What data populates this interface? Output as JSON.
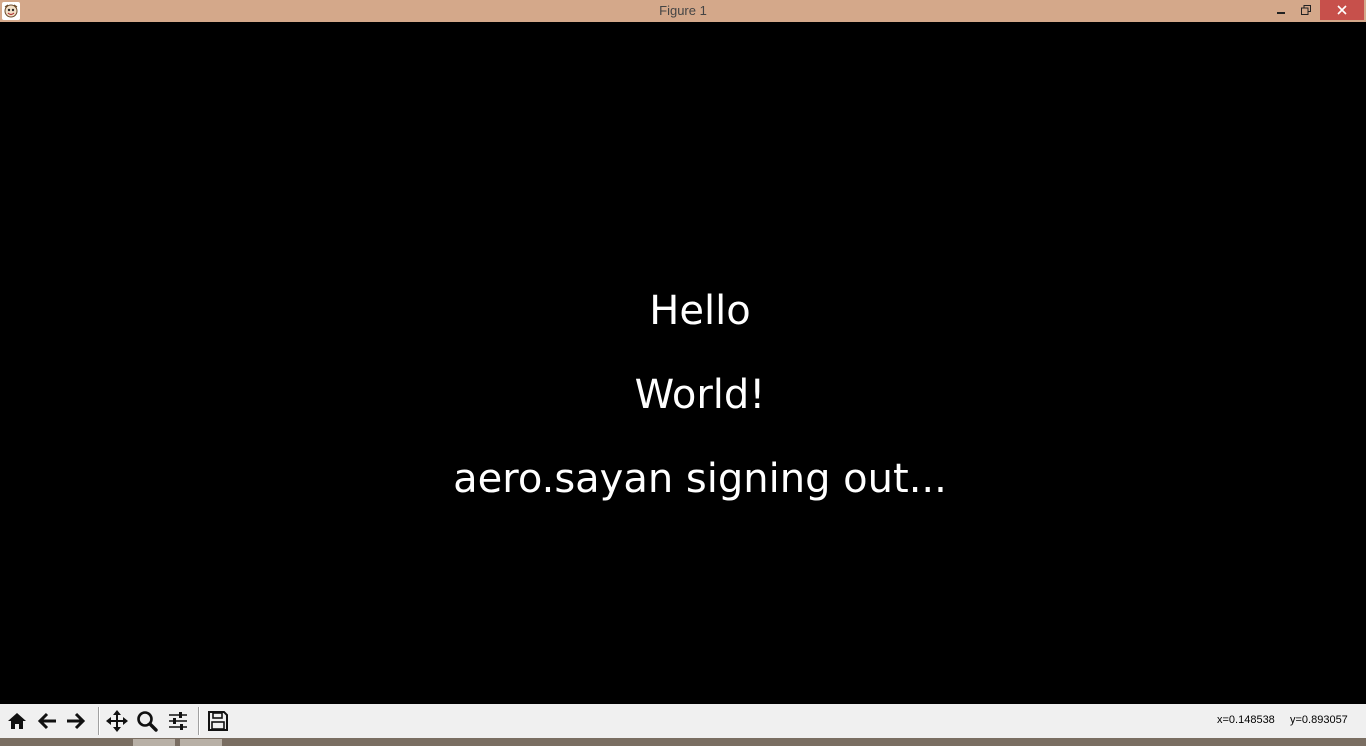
{
  "window": {
    "title": "Figure 1",
    "titlebar_color": "#d4a88a",
    "close_color": "#c7504b",
    "buttons": {
      "minimize": "minimize-icon",
      "maximize": "restore-icon",
      "close": "close-icon"
    }
  },
  "figure": {
    "background": "#000000",
    "text_color": "#ffffff",
    "lines": [
      "Hello",
      "World!",
      "aero.sayan signing out..."
    ]
  },
  "toolbar": {
    "buttons": [
      {
        "name": "home",
        "icon": "home-icon"
      },
      {
        "name": "back",
        "icon": "arrow-left-icon"
      },
      {
        "name": "forward",
        "icon": "arrow-right-icon"
      },
      {
        "name": "pan",
        "icon": "move-icon"
      },
      {
        "name": "zoom",
        "icon": "magnifier-icon"
      },
      {
        "name": "configure",
        "icon": "sliders-icon"
      },
      {
        "name": "save",
        "icon": "floppy-disk-icon"
      }
    ],
    "x_readout": "x=0.148538",
    "y_readout": "y=0.893057"
  }
}
